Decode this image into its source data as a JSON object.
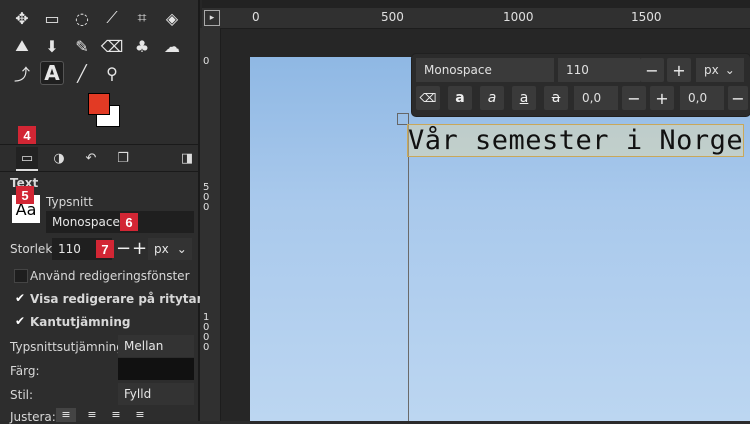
{
  "toolbox": {
    "tools": [
      "move-icon",
      "rect-select-icon",
      "lasso-icon",
      "fuzzy-select-icon",
      "crop-icon",
      "transform-icon",
      "warp-icon",
      "bucket-fill-icon",
      "paintbrush-icon",
      "eraser-icon",
      "clone-icon",
      "smudge-icon",
      "paths-icon",
      "text-tool-icon",
      "color-picker-icon",
      "zoom-icon"
    ],
    "text_tool_glyph": "A",
    "fg_color": "#e23a24",
    "bg_color": "#ffffff",
    "badges": {
      "b4": "4",
      "b5": "5",
      "b6": "6",
      "b7": "7"
    },
    "options": {
      "section_title": "Text",
      "font_label": "Typsnitt",
      "font_preview": "Aa",
      "font_value": "Monospace",
      "size_label": "Storlek:",
      "size_value": "110",
      "size_unit": "px",
      "use_editor": "Använd redigeringsfönster",
      "show_editor": "Visa redigerare på ritytan",
      "antialias": "Kantutjämning",
      "hinting_label": "Typsnittsutjämning:",
      "hinting_value": "Mellan",
      "color_label": "Färg:",
      "style_label": "Stil:",
      "style_value": "Fylld",
      "justify_label": "Justera:"
    }
  },
  "rulers": {
    "top_ticks": [
      "0",
      "500",
      "1000",
      "1500"
    ],
    "left_ticks": [
      "0",
      "500",
      "1000"
    ]
  },
  "text_toolbar": {
    "font": "Monospace",
    "size": "110",
    "unit": "px",
    "baseline": "0,0",
    "kerning": "0,0",
    "style_buttons": [
      "a",
      "a",
      "a",
      "a"
    ]
  },
  "canvas": {
    "text": "Vår semester i Norge"
  }
}
